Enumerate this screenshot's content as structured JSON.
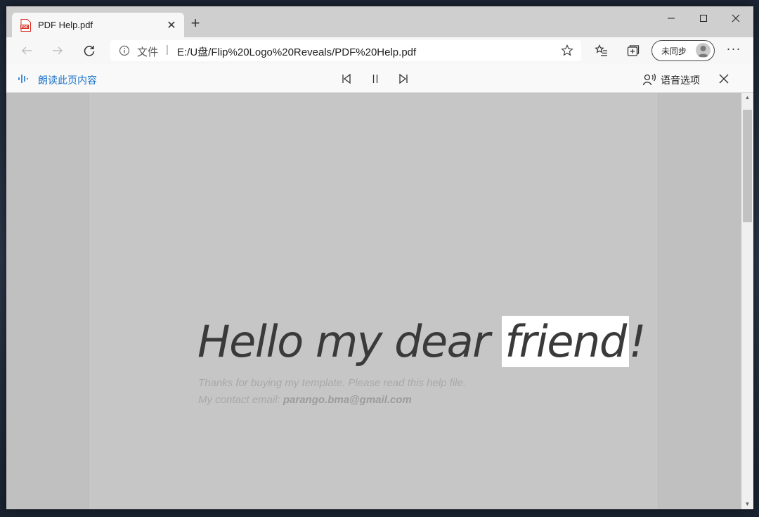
{
  "browser": {
    "tab": {
      "title": "PDF Help.pdf",
      "icon": "pdf-file-icon",
      "close_glyph": "✕"
    },
    "new_tab_glyph": "+",
    "window_controls": {
      "minimize_glyph": "—",
      "maximize_glyph": "☐",
      "close_glyph": "✕"
    }
  },
  "address_bar": {
    "scheme_label": "文件",
    "separator": "|",
    "url": "E:/U盘/Flip%20Logo%20Reveals/PDF%20Help.pdf"
  },
  "toolbar": {
    "sync_label": "未同步",
    "more_glyph": "···"
  },
  "read_aloud": {
    "label": "朗读此页内容",
    "voice_options_label": "语音选项"
  },
  "document": {
    "heading_before": "Hello my dear ",
    "heading_highlight": "friend",
    "heading_after": "!",
    "thanks_line": "Thanks for buying my template. Please read this help file.",
    "contact_prefix": "My contact email: ",
    "contact_email": "parango.bma@gmail.com"
  },
  "colors": {
    "accent": "#1a73c8",
    "page_background": "#c6c6c6",
    "highlight": "#ffffff"
  }
}
